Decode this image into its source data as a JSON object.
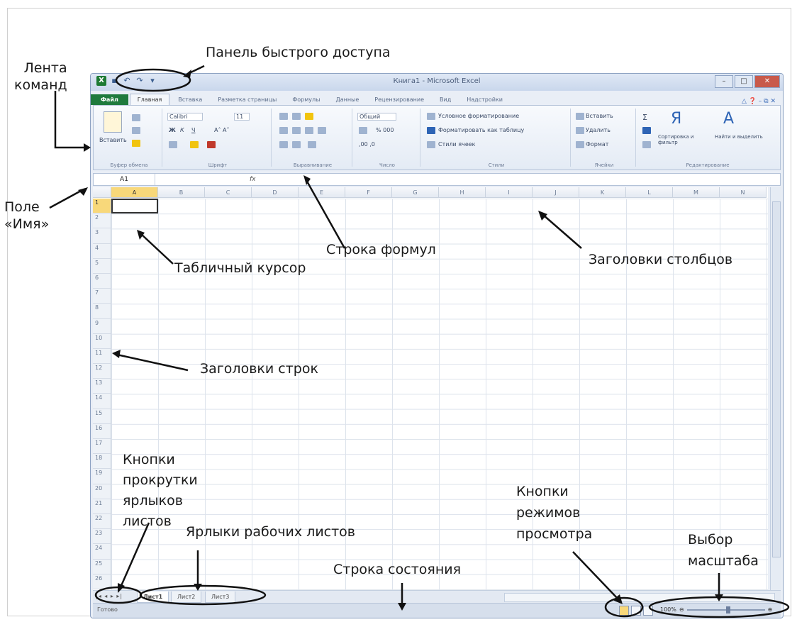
{
  "excel": {
    "title": "Книга1 - Microsoft Excel",
    "tabs": {
      "file": "Файл",
      "items": [
        "Главная",
        "Вставка",
        "Разметка страницы",
        "Формулы",
        "Данные",
        "Рецензирование",
        "Вид",
        "Надстройки"
      ]
    },
    "ribbon": {
      "clipboard": "Буфер обмена",
      "paste": "Вставить",
      "font_name": "Calibri",
      "font_size": "11",
      "font_group": "Шрифт",
      "alignment_group": "Выравнивание",
      "number_format": "Общий",
      "number_group": "Число",
      "cond_format": "Условное форматирование",
      "format_table": "Форматировать как таблицу",
      "cell_styles": "Стили ячеек",
      "styles_group": "Стили",
      "insert": "Вставить",
      "delete": "Удалить",
      "format": "Формат",
      "cells_group": "Ячейки",
      "sort_filter": "Сортировка и фильтр",
      "find_select": "Найти и выделить",
      "editing_group": "Редактирование"
    },
    "name_box": "A1",
    "fx": "fx",
    "columns": [
      "A",
      "B",
      "C",
      "D",
      "E",
      "F",
      "G",
      "H",
      "I",
      "J",
      "K",
      "L",
      "M",
      "N"
    ],
    "rows": [
      "1",
      "2",
      "3",
      "4",
      "5",
      "6",
      "7",
      "8",
      "9",
      "10",
      "11",
      "12",
      "13",
      "14",
      "15",
      "16",
      "17",
      "18",
      "19",
      "20",
      "21",
      "22",
      "23",
      "24",
      "25",
      "26"
    ],
    "sheets": [
      "Лист1",
      "Лист2",
      "Лист3"
    ],
    "status": "Готово",
    "zoom": "100%"
  },
  "annotations": {
    "qat": "Панель быстрого доступа",
    "ribbon": "Лента\nкоманд",
    "name_field": "Поле\n«Имя»",
    "formula_bar": "Строка формул",
    "table_cursor": "Табличный курсор",
    "col_headers": "Заголовки столбцов",
    "row_headers": "Заголовки строк",
    "scroll_buttons": "Кнопки\nпрокрутки\nярлыков\nлистов",
    "sheet_tabs": "Ярлыки рабочих листов",
    "status_bar": "Строка состояния",
    "view_buttons": "Кнопки\nрежимов\nпросмотра",
    "zoom": "Выбор\nмасштаба"
  }
}
